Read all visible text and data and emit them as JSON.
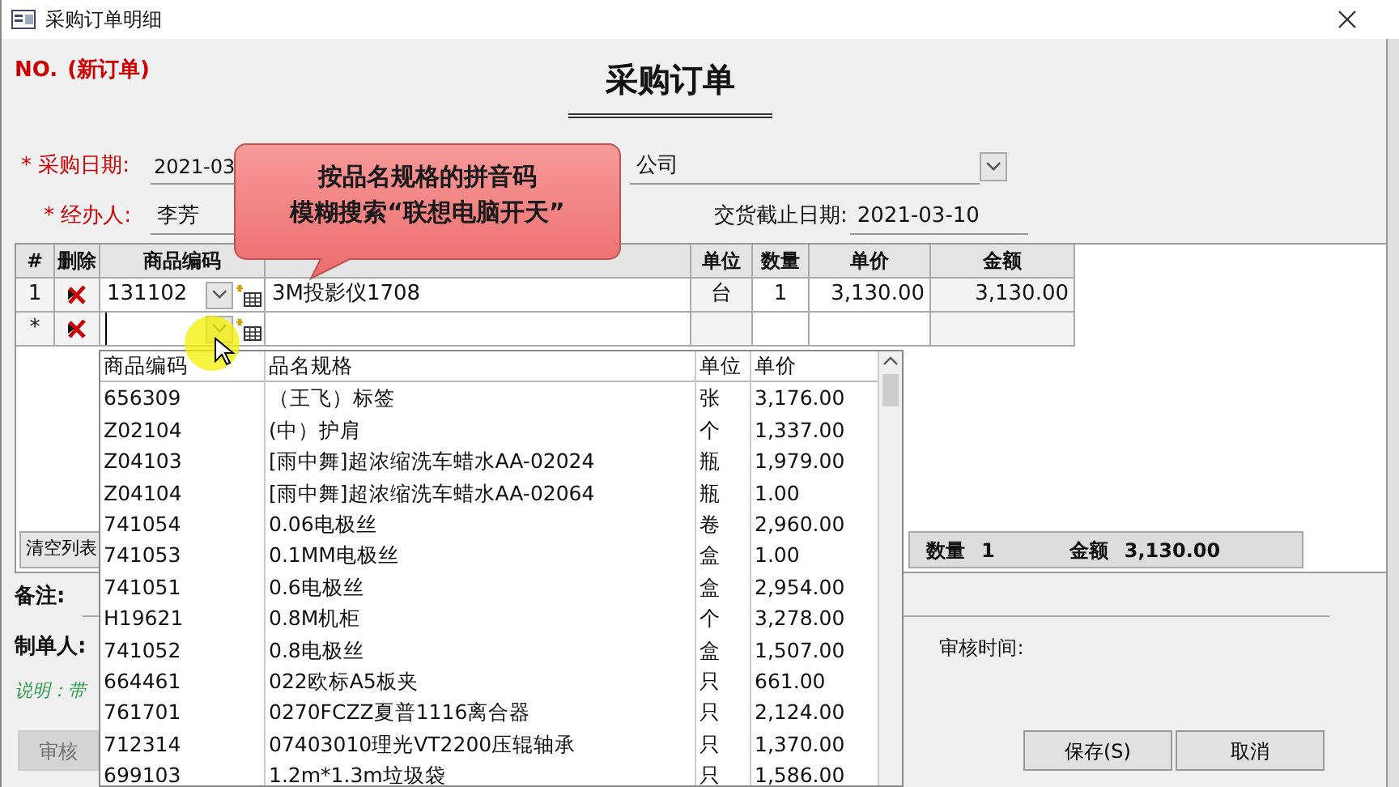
{
  "window": {
    "title": "采购订单明细"
  },
  "header": {
    "number_label": "NO.",
    "number_value": "(新订单)",
    "title": "采购订单"
  },
  "purchase_date": {
    "label": "* 采购日期:",
    "required": true,
    "value": "2021-03"
  },
  "supplier": {
    "value": "公司"
  },
  "handler": {
    "label": "* 经办人:",
    "required": true,
    "value": "李芳"
  },
  "deadline": {
    "label": "交货截止日期:",
    "required": false,
    "value": "2021-03-10"
  },
  "grid": {
    "columns": [
      {
        "kind": "text",
        "label": "#"
      },
      {
        "kind": "text",
        "label": "删除"
      },
      {
        "kind": "text",
        "label": "商品编码"
      },
      {
        "kind": "covered"
      },
      {
        "kind": "text",
        "label": "单位"
      },
      {
        "kind": "text",
        "label": "数量"
      },
      {
        "kind": "text",
        "label": "单价"
      },
      {
        "kind": "text",
        "label": "金额"
      }
    ],
    "rows": [
      {
        "marker": "1",
        "code": "131102",
        "name": "3M投影仪1708",
        "unit": "台",
        "qty": "1",
        "price": "3,130.00",
        "amount": "3,130.00"
      },
      {
        "marker": "*"
      }
    ]
  },
  "clear_button": "清空列表",
  "totals": {
    "qty_label": "数量",
    "qty": "1",
    "amount_label": "金额",
    "amount": "3,130.00"
  },
  "remarks_label": "备注:",
  "creator_label": "制单人:",
  "audit_time_label": "审核时间:",
  "note": "说明：带",
  "buttons": [
    {
      "label": "审核",
      "disabled": true
    },
    {
      "label": "保存(S)",
      "disabled": false
    },
    {
      "label": "取消",
      "disabled": false
    }
  ],
  "dropdown": {
    "columns": [
      "商品编码",
      "品名规格",
      "单位",
      "单价"
    ],
    "rows": [
      [
        "656309",
        "（王飞）标签",
        "张",
        "3,176.00"
      ],
      [
        "Z02104",
        "(中）护肩",
        "个",
        "1,337.00"
      ],
      [
        "Z04103",
        "[雨中舞]超浓缩洗车蜡水AA-02024",
        "瓶",
        "1,979.00"
      ],
      [
        "Z04104",
        "[雨中舞]超浓缩洗车蜡水AA-02064",
        "瓶",
        "1.00"
      ],
      [
        "741054",
        "0.06电极丝",
        "卷",
        "2,960.00"
      ],
      [
        "741053",
        "0.1MM电极丝",
        "盒",
        "1.00"
      ],
      [
        "741051",
        "0.6电极丝",
        "盒",
        "2,954.00"
      ],
      [
        "H19621",
        "0.8M机柜",
        "个",
        "3,278.00"
      ],
      [
        "741052",
        "0.8电极丝",
        "盒",
        "1,507.00"
      ],
      [
        "664461",
        "022欧标A5板夹",
        "只",
        "661.00"
      ],
      [
        "761701",
        "0270FCZZ夏普1116离合器",
        "只",
        "2,124.00"
      ],
      [
        "712314",
        "07403010理光VT2200压辊轴承",
        "只",
        "1,370.00"
      ],
      [
        "699103",
        "1.2m*1.3m垃圾袋",
        "只",
        "1,586.00"
      ]
    ]
  },
  "callout": {
    "lines": [
      "按品名规格的拼音码",
      "模糊搜索“联想电脑开天”"
    ]
  }
}
